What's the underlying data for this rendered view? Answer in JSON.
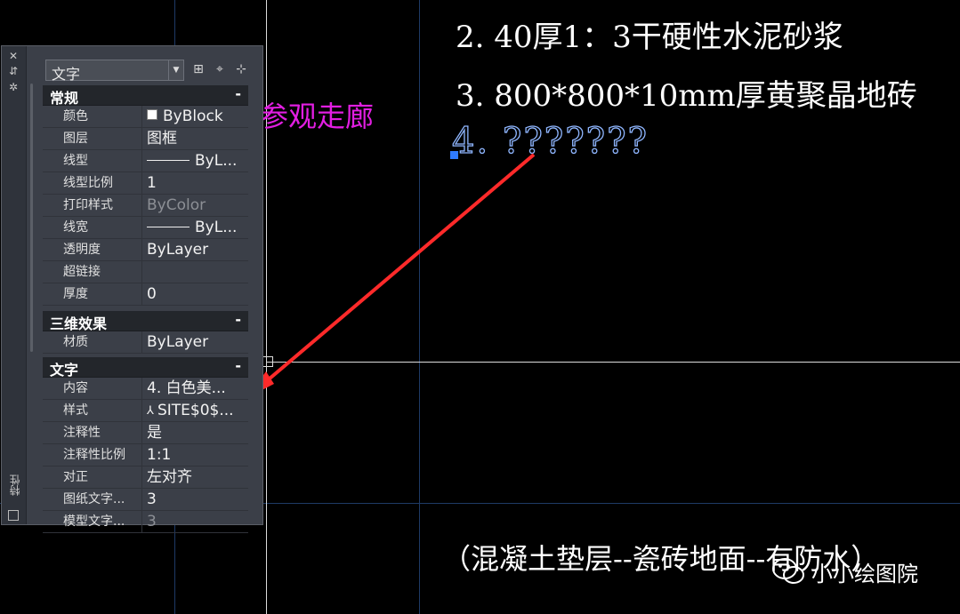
{
  "canvas": {
    "line2": "2. 40厚1：3干硬性水泥砂浆",
    "line3": "3. 800*800*10mm厚黄聚晶地砖",
    "line4": "4. ???????",
    "magenta_text": "参观走廊",
    "bottom_note": "（混凝土垫层--瓷砖地面--有防水）"
  },
  "watermark": {
    "text": "小小绘图院"
  },
  "palette": {
    "side_title": "特性",
    "object_type": "文字",
    "toolbar": {
      "quick_select_icon": "quick-select-icon",
      "select_objects_icon": "select-objects-icon",
      "toggle_pickadd_icon": "toggle-pickadd-icon"
    },
    "sections": {
      "general": {
        "title": "常规",
        "toggle": "-",
        "rows": [
          {
            "key": "颜色",
            "value": "ByBlock"
          },
          {
            "key": "图层",
            "value": "图框"
          },
          {
            "key": "线型",
            "value": "ByL..."
          },
          {
            "key": "线型比例",
            "value": "1"
          },
          {
            "key": "打印样式",
            "value": "ByColor"
          },
          {
            "key": "线宽",
            "value": "ByL..."
          },
          {
            "key": "透明度",
            "value": "ByLayer"
          },
          {
            "key": "超链接",
            "value": ""
          },
          {
            "key": "厚度",
            "value": "0"
          }
        ]
      },
      "3d": {
        "title": "三维效果",
        "toggle": "-",
        "rows": [
          {
            "key": "材质",
            "value": "ByLayer"
          }
        ]
      },
      "text": {
        "title": "文字",
        "toggle": "-",
        "rows": [
          {
            "key": "内容",
            "value": "4. 白色美..."
          },
          {
            "key": "样式",
            "value": "SITE$0$..."
          },
          {
            "key": "注释性",
            "value": "是"
          },
          {
            "key": "注释性比例",
            "value": "1:1"
          },
          {
            "key": "对正",
            "value": "左对齐"
          },
          {
            "key": "图纸文字...",
            "value": "3"
          },
          {
            "key": "模型文字...",
            "value": "3"
          }
        ]
      }
    }
  },
  "colors": {
    "canvas_bg": "#000000",
    "grid_line": "#1e3a66",
    "selected_text": "#8fb6ff",
    "magenta": "#e21ee2",
    "arrow": "#ff2a2a",
    "palette_bg": "#3b3f48"
  }
}
